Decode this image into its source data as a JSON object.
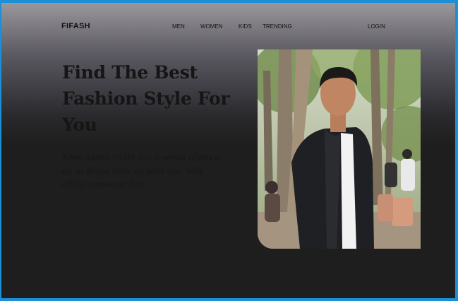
{
  "header": {
    "logo": "FIFASH",
    "nav": [
      "MEN",
      "WOMEN",
      "KIDS",
      "TRENDING"
    ],
    "login": "LOGIN"
  },
  "hero": {
    "headline": "Find  The Best Fashion Style For You",
    "body": "Amet minim mollit non deserunt ullamco est sit aliqua dolor do amet sint. Velit officia consequat duis",
    "image_alt": "man-in-black-jacket-photo"
  },
  "colors": {
    "frame_border": "#1d8fd6",
    "background_top": "#9a979c",
    "background_bottom": "#1e1e1e",
    "text_dark": "#111111"
  }
}
